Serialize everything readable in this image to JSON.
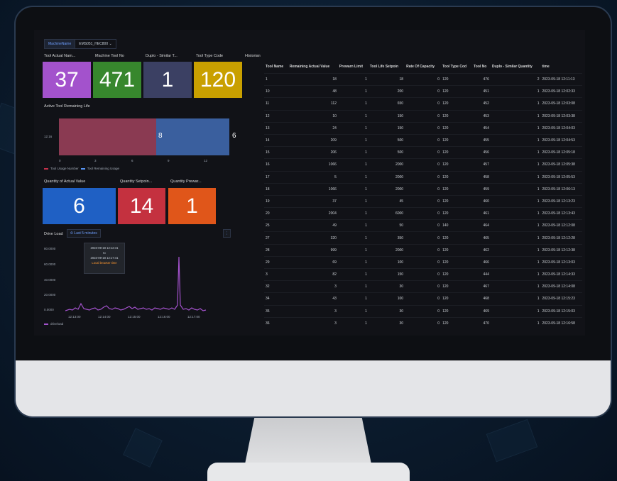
{
  "dashboard": {
    "variable": {
      "name": "MachineName",
      "value": "EMS051_HEC800 ⌄"
    },
    "stats": [
      {
        "title": "Tool Actual Nam...",
        "value": "37",
        "color": "#a352cc"
      },
      {
        "title": "Machine Tool No",
        "value": "471",
        "color": "#37872d"
      },
      {
        "title": "Duplo - Similar T...",
        "value": "1",
        "color": "#3b4063"
      },
      {
        "title": "Tool Type Code",
        "value": "120",
        "color": "#c9a000"
      }
    ],
    "remaining_life": {
      "title": "Active Tool Remaining Life",
      "row_label": "12:16",
      "usage_value": "8",
      "remaining_value": "6",
      "x_ticks": [
        "0",
        "3",
        "6",
        "9",
        "12"
      ],
      "legend": [
        "Tool Usage Number",
        "Tool Remaining Usage"
      ],
      "colors": {
        "usage": "#8a3a52",
        "remaining": "#3a5f9e"
      }
    },
    "quantity": [
      {
        "title": "Quantity of Actual Value",
        "value": "6",
        "color": "#1f60c4"
      },
      {
        "title": "Quantity Setpoin...",
        "value": "14",
        "color": "#c4313f"
      },
      {
        "title": "Quantity Prewar...",
        "value": "1",
        "color": "#e0561a"
      }
    ],
    "drive_load": {
      "title": "Drive Load",
      "time_button": "⏲ Last 5 minutes",
      "y_ticks": [
        "80.0000",
        "60.0000",
        "40.0000",
        "20.0000",
        "0.0000"
      ],
      "x_ticks": [
        "12:13:00",
        "12:14:00",
        "12:15:00",
        "12:16:00",
        "12:17:00"
      ],
      "legend": "driveload",
      "tooltip": {
        "from": "2023-09-18 12:12:41",
        "to_label": "to",
        "to": "2023-09-18 12:17:41",
        "tz": "Local browser time"
      },
      "color": "#a352cc"
    },
    "historian": {
      "title": "Historian",
      "columns": [
        "Tool Name",
        "Remaining Actual Value",
        "Prewarn Limit",
        "Tool Life Setpoin",
        "Rate Of Capacity",
        "Tool Type Cod",
        "Tool No",
        "Duplo - Similar Quantity",
        "time"
      ],
      "rows": [
        [
          "1",
          "18",
          "1",
          "18",
          "0",
          "120",
          "476",
          "2",
          "2023-09-18 12:11:13"
        ],
        [
          "10",
          "48",
          "1",
          "200",
          "0",
          "120",
          "451",
          "1",
          "2023-09-18 12:02:33"
        ],
        [
          "11",
          "112",
          "1",
          "650",
          "0",
          "120",
          "452",
          "1",
          "2023-09-18 12:03:08"
        ],
        [
          "12",
          "10",
          "1",
          "150",
          "0",
          "120",
          "453",
          "1",
          "2023-09-18 12:03:38"
        ],
        [
          "13",
          "24",
          "1",
          "150",
          "0",
          "120",
          "454",
          "1",
          "2023-09-18 12:04:03"
        ],
        [
          "14",
          "209",
          "1",
          "500",
          "0",
          "120",
          "455",
          "1",
          "2023-09-18 12:04:53"
        ],
        [
          "15",
          "206",
          "1",
          "500",
          "0",
          "120",
          "456",
          "1",
          "2023-09-18 12:05:18"
        ],
        [
          "16",
          "1066",
          "1",
          "2000",
          "0",
          "120",
          "457",
          "1",
          "2023-09-18 12:05:38"
        ],
        [
          "17",
          "5",
          "1",
          "2000",
          "0",
          "120",
          "458",
          "1",
          "2023-09-18 12:05:53"
        ],
        [
          "18",
          "1066",
          "1",
          "2000",
          "0",
          "120",
          "459",
          "1",
          "2023-09-18 12:06:13"
        ],
        [
          "19",
          "37",
          "1",
          "45",
          "0",
          "120",
          "460",
          "1",
          "2023-09-18 12:13:23"
        ],
        [
          "20",
          "2004",
          "1",
          "6000",
          "0",
          "120",
          "461",
          "1",
          "2023-09-18 12:13:43"
        ],
        [
          "25",
          "49",
          "1",
          "50",
          "0",
          "140",
          "464",
          "1",
          "2023-09-18 12:12:08"
        ],
        [
          "27",
          "320",
          "1",
          "350",
          "0",
          "120",
          "465",
          "1",
          "2023-09-18 12:12:28"
        ],
        [
          "28",
          "999",
          "1",
          "2000",
          "0",
          "120",
          "462",
          "1",
          "2023-09-18 12:12:38"
        ],
        [
          "29",
          "69",
          "1",
          "100",
          "0",
          "120",
          "466",
          "1",
          "2023-09-18 12:13:03"
        ],
        [
          "3",
          "82",
          "1",
          "150",
          "0",
          "120",
          "444",
          "1",
          "2023-09-18 12:14:33"
        ],
        [
          "32",
          "3",
          "1",
          "30",
          "0",
          "120",
          "467",
          "1",
          "2023-09-18 12:14:08"
        ],
        [
          "34",
          "43",
          "1",
          "100",
          "0",
          "120",
          "468",
          "1",
          "2023-09-18 12:15:23"
        ],
        [
          "35",
          "3",
          "1",
          "30",
          "0",
          "120",
          "469",
          "1",
          "2023-09-18 12:15:03"
        ],
        [
          "36",
          "3",
          "1",
          "30",
          "0",
          "120",
          "470",
          "1",
          "2023-09-18 12:16:58"
        ]
      ]
    }
  }
}
